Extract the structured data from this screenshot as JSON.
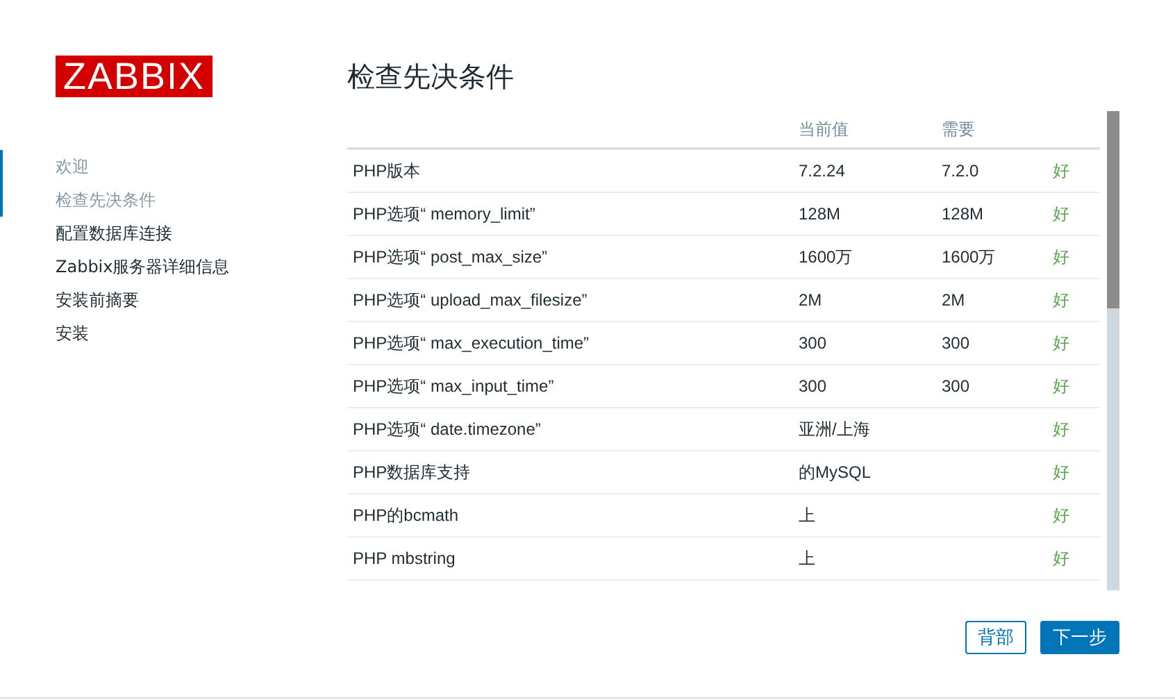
{
  "logo": "ZABBIX",
  "steps": [
    {
      "label": "欢迎",
      "completed": true
    },
    {
      "label": "检查先决条件",
      "completed": true
    },
    {
      "label": "配置数据库连接",
      "completed": false
    },
    {
      "label": "Zabbix服务器详细信息",
      "completed": false
    },
    {
      "label": "安装前摘要",
      "completed": false
    },
    {
      "label": "安装",
      "completed": false
    }
  ],
  "title": "检查先决条件",
  "table": {
    "columns": [
      "当前值",
      "需要"
    ],
    "rows": [
      {
        "name": "PHP版本",
        "current": "7.2.24",
        "required": "7.2.0",
        "status": "好",
        "ok": true
      },
      {
        "name": "PHP选项“ memory_limit”",
        "current": "128M",
        "required": "128M",
        "status": "好",
        "ok": true
      },
      {
        "name": "PHP选项“ post_max_size”",
        "current": "1600万",
        "required": "1600万",
        "status": "好",
        "ok": true
      },
      {
        "name": "PHP选项“ upload_max_filesize”",
        "current": "2M",
        "required": "2M",
        "status": "好",
        "ok": true
      },
      {
        "name": "PHP选项“ max_execution_time”",
        "current": "300",
        "required": "300",
        "status": "好",
        "ok": true
      },
      {
        "name": "PHP选项“ max_input_time”",
        "current": "300",
        "required": "300",
        "status": "好",
        "ok": true
      },
      {
        "name": "PHP选项“ date.timezone”",
        "current": "亚洲/上海",
        "status": "好",
        "ok": true
      },
      {
        "name": "PHP数据库支持",
        "current": "的MySQL",
        "status": "好",
        "ok": true
      },
      {
        "name": "PHP的bcmath",
        "current": "上",
        "status": "好",
        "ok": true
      },
      {
        "name": "PHP mbstring",
        "current": "上",
        "status": "好",
        "ok": true
      }
    ]
  },
  "buttons": {
    "back": "背部",
    "next": "下一步"
  }
}
